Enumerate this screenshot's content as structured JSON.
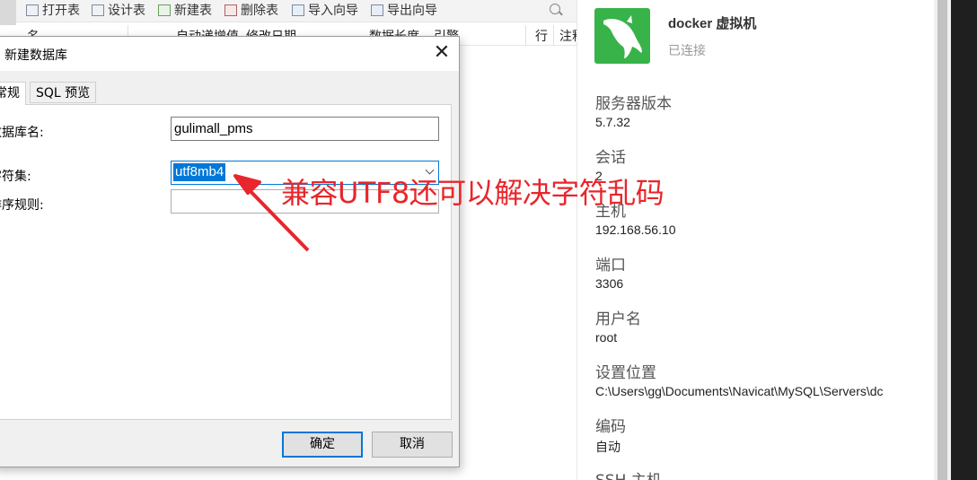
{
  "toolbar": {
    "open_table": "打开表",
    "design_table": "设计表",
    "new_table": "新建表",
    "delete_table": "删除表",
    "import_wizard": "导入向导",
    "export_wizard": "导出向导"
  },
  "table_header": {
    "col_name": "名",
    "col_auto_inc": "自动递增值",
    "col_modified": "修改日期",
    "col_data_len": "数据长度",
    "col_engine": "引擎",
    "col_rows": "行",
    "col_comment": "注释"
  },
  "dialog": {
    "title": "新建数据库",
    "tabs": [
      "常规",
      "SQL 预览"
    ],
    "db_name_label": "数据库名:",
    "db_name_value": "gulimall_pms",
    "charset_label": "字符集:",
    "charset_value": "utf8mb4",
    "collation_label": "排序规则:",
    "collation_value": "",
    "ok_button": "确定",
    "cancel_button": "取消"
  },
  "annotation": {
    "text": "兼容UTF8还可以解决字符乱码",
    "color": "#e8262b"
  },
  "connection": {
    "name": "docker 虚拟机",
    "status": "已连接",
    "logo_color": "#38b349",
    "fields": [
      {
        "label": "服务器版本",
        "value": "5.7.32"
      },
      {
        "label": "会话",
        "value": "2"
      },
      {
        "label": "主机",
        "value": "192.168.56.10"
      },
      {
        "label": "端口",
        "value": "3306"
      },
      {
        "label": "用户名",
        "value": "root"
      },
      {
        "label": "设置位置",
        "value": "C:\\Users\\gg\\Documents\\Navicat\\MySQL\\Servers\\dc"
      },
      {
        "label": "编码",
        "value": "自动"
      },
      {
        "label": "SSH 主机",
        "value": ""
      }
    ]
  }
}
